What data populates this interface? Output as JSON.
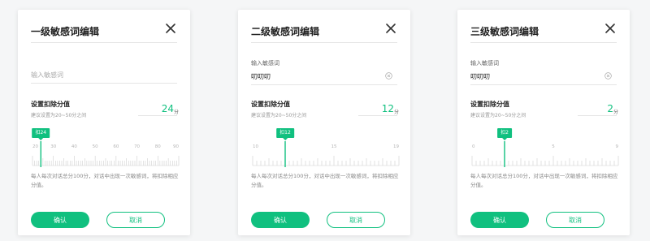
{
  "theme": {
    "accent": "#10c07f",
    "tick": "#cfcfcf",
    "tick_label": "#b5b5b5"
  },
  "cards": [
    {
      "title": "一级敏感词编辑",
      "close_icon": "close-icon",
      "field_label": "",
      "field_value": "",
      "field_placeholder": "输入敏感词",
      "deduct_title": "设置扣除分值",
      "deduct_hint": "建议设置为20~50分之间",
      "score": "24",
      "unit": "分",
      "slider": {
        "min": 20,
        "max": 90,
        "value": 24,
        "tag": "扣24",
        "labels": [
          "20",
          "30",
          "40",
          "50",
          "60",
          "70",
          "80",
          "90"
        ]
      },
      "note": "每人每次对话总分100分，对话中出现一次敏感词，将扣除相应分值。",
      "confirm": "确认",
      "cancel": "取消"
    },
    {
      "title": "二级敏感词编辑",
      "close_icon": "close-icon",
      "field_label": "输入敏感词",
      "field_value": "叨叨叨",
      "field_placeholder": "",
      "clear_icon": "clear-circle-icon",
      "deduct_title": "设置扣除分值",
      "deduct_hint": "建议设置为20~50分之间",
      "score": "12",
      "unit": "分",
      "slider": {
        "min": 10,
        "max": 19,
        "value": 12,
        "tag": "扣12",
        "labels": [
          "10",
          "15",
          "19"
        ]
      },
      "note": "每人每次对话总分100分，对话中出现一次敏感词，将扣除相应分值。",
      "confirm": "确认",
      "cancel": "取消"
    },
    {
      "title": "三级敏感词编辑",
      "close_icon": "close-icon",
      "field_label": "输入敏感词",
      "field_value": "叨叨叨",
      "field_placeholder": "",
      "clear_icon": "clear-circle-icon",
      "deduct_title": "设置扣除分值",
      "deduct_hint": "建议设置为20~50分之间",
      "score": "2",
      "unit": "分",
      "slider": {
        "min": 0,
        "max": 9,
        "value": 2,
        "tag": "扣2",
        "labels": [
          "0",
          "5",
          "9"
        ]
      },
      "note": "每人每次对话总分100分，对话中出现一次敏感词，将扣除相应分值。",
      "confirm": "确认",
      "cancel": "取消"
    }
  ]
}
